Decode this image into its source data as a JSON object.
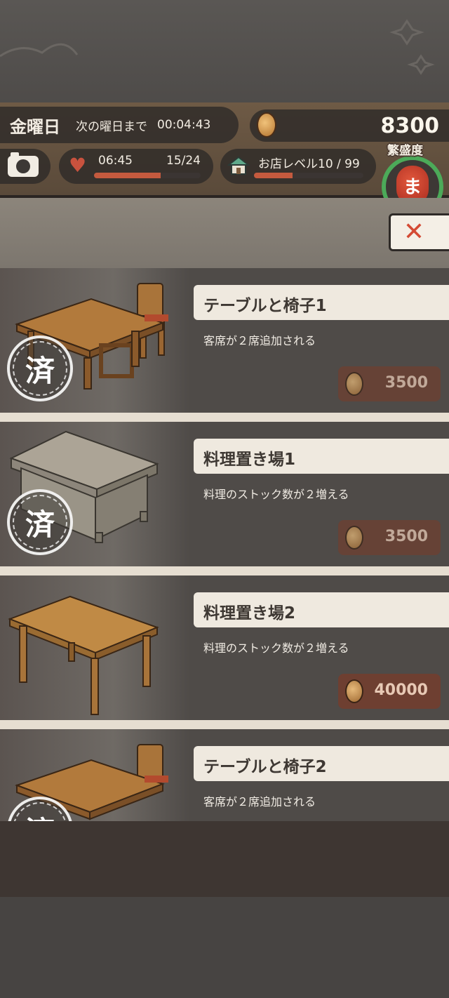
{
  "hud": {
    "day": "金曜日",
    "next_day_label": "次の曜日まで",
    "timer": "00:04:43",
    "money": "8300",
    "heart_time": "06:45",
    "heart_count": "15/24",
    "heart_progress": 0.625,
    "shop_level": "お店レベル10 / 99",
    "shop_progress": 0.35,
    "popularity_label": "繁盛度",
    "lantern_char": "ま"
  },
  "close_button": {
    "label": "✕"
  },
  "items": [
    {
      "title": "テーブルと椅子1",
      "desc": "客席が２席追加される",
      "price": "3500",
      "owned": true,
      "owned_mark": "済",
      "art": "table-chair"
    },
    {
      "title": "料理置き場1",
      "desc": "料理のストック数が２増える",
      "price": "3500",
      "owned": true,
      "owned_mark": "済",
      "art": "counter"
    },
    {
      "title": "料理置き場2",
      "desc": "料理のストック数が２増える",
      "price": "40000",
      "owned": false,
      "art": "table"
    },
    {
      "title": "テーブルと椅子2",
      "desc": "客席が２席追加される",
      "owned": true,
      "owned_mark": "済",
      "art": "table-chair"
    }
  ],
  "colors": {
    "accent_red": "#c45a3e",
    "price_bg": "#6e3f31",
    "popularity_ring": "#4caa59"
  }
}
